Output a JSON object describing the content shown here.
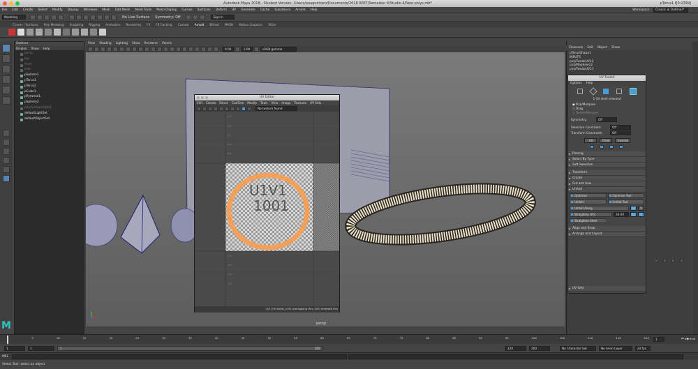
{
  "window": {
    "title": "Autodesk Maya 2018 - Student Version: /Users/anaquintero/Documents/2018 RMIT/Semester 4/Studio 4/New polys.mb*",
    "selection": "pTorus1.f[0:2399]"
  },
  "menubar": [
    "File",
    "Edit",
    "Create",
    "Select",
    "Modify",
    "Display",
    "Windows",
    "Mesh",
    "Edit Mesh",
    "Mesh Tools",
    "Mesh Display",
    "Curves",
    "Surfaces",
    "Deform",
    "UV",
    "Generate",
    "Cache",
    "Substance",
    "Arnold",
    "Help"
  ],
  "workspace": {
    "label": "Workspace :",
    "value": "Classic w Outliner*"
  },
  "statusline": {
    "mode": "Modeling",
    "live": "No Live Surface",
    "symmetry": "Symmetry: Off",
    "signin": "Sign In"
  },
  "shelf_tabs": [
    {
      "label": "Curves / Surfaces",
      "active": false
    },
    {
      "label": "Poly Modeling",
      "active": false
    },
    {
      "label": "Sculpting",
      "active": false
    },
    {
      "label": "Rigging",
      "active": false
    },
    {
      "label": "Animation",
      "active": false
    },
    {
      "label": "Rendering",
      "active": false
    },
    {
      "label": "FX",
      "active": false
    },
    {
      "label": "FX Caching",
      "active": false
    },
    {
      "label": "Custom",
      "active": false
    },
    {
      "label": "Arnold",
      "active": true
    },
    {
      "label": "Bifrost",
      "active": false
    },
    {
      "label": "MASH",
      "active": false
    },
    {
      "label": "Motion Graphics",
      "active": false
    },
    {
      "label": "XGen",
      "active": false
    }
  ],
  "outliner": {
    "title": "Outliner",
    "menu": [
      "Display",
      "Show",
      "Help"
    ],
    "items": [
      {
        "label": "persp",
        "dim": true
      },
      {
        "label": "top",
        "dim": true
      },
      {
        "label": "front",
        "dim": true
      },
      {
        "label": "side",
        "dim": true
      },
      {
        "label": "pSphere1",
        "dim": false
      },
      {
        "label": "pTorus1",
        "dim": false
      },
      {
        "label": "pTorus2",
        "dim": false
      },
      {
        "label": "pCube1",
        "dim": false
      },
      {
        "label": "pPyramid1",
        "dim": false
      },
      {
        "label": "pSphere2",
        "dim": false
      },
      {
        "label": "polySurfaceLight1",
        "dim": true
      },
      {
        "label": "defaultLightSet",
        "dim": false
      },
      {
        "label": "defaultObjectSet",
        "dim": false
      }
    ]
  },
  "viewport": {
    "menu": [
      "View",
      "Shading",
      "Lighting",
      "Show",
      "Renderer",
      "Panels"
    ],
    "exposure": "0.00",
    "gamma": "1.00",
    "colorspace": "sRGB gamma",
    "camera": "persp"
  },
  "uv_editor": {
    "title": "UV Editor",
    "menu": [
      "Edit",
      "Create",
      "Select",
      "Cut/Sew",
      "Modify",
      "Tools",
      "View",
      "Image",
      "Textures",
      "UV Sets"
    ],
    "texture_field": "No texture found",
    "tile_label_a": "U1V1",
    "tile_label_b": "1001",
    "status": "(1/1) UV shells, (0/0) overlapping UVs, (0/0) reversed UVs",
    "ruler_left": [
      "1.3",
      "1.2",
      "1.1",
      "1.0",
      "0.9",
      "0.8",
      "0.7",
      "0.6",
      "0.5",
      "0.4",
      "0.3",
      "0.2",
      "0.1",
      "0.0",
      "-0.1",
      "-0.2",
      "-0.3",
      "-0.4",
      "-0.5"
    ]
  },
  "channel_box": {
    "menu": [
      "Channels",
      "Edit",
      "Object",
      "Show"
    ],
    "object": "pTorusShape1",
    "inputs_label": "INPUTS",
    "inputs": [
      "polyTweakUV12",
      "polyMapSew12",
      "polyTweakUV11"
    ]
  },
  "uv_toolkit": {
    "title": "UV Toolkit",
    "menu": [
      "Options",
      "Help"
    ],
    "selection_info": "1 UV shell selected",
    "modes": [
      "Pick/Marquee",
      "Drag",
      "Tweak/Marquee"
    ],
    "symmetry_label": "Symmetry:",
    "symmetry_value": "Off",
    "sel_constraint_label": "Selection Constraint:",
    "sel_constraint_value": "Off",
    "trans_constraint_label": "Transform Constraint:",
    "trans_constraint_value": "Off",
    "select_buttons": [
      "All",
      "Clear",
      "Inverse"
    ],
    "sections_top": [
      "Pinning",
      "Select By Type",
      "Soft Selection"
    ],
    "sections_mid": [
      "Transform",
      "Create",
      "Cut and Sew"
    ],
    "unfold_section": "Unfold",
    "unfold_buttons": [
      [
        "Optimize",
        "Optimize Tool"
      ],
      [
        "Unfold",
        "Unfold Tool"
      ]
    ],
    "unfold_along": "Unfold Along",
    "unfold_u": "U",
    "unfold_v": "V",
    "straighten_uvs": "Straighten UVs",
    "straighten_value": "30.00",
    "straighten_shell": "Straighten Shell",
    "sections_bottom": [
      "Align and Snap",
      "Arrange and Layout"
    ],
    "uv_sets": "UV Sets"
  },
  "timeline": {
    "ticks": [
      "1",
      "5",
      "10",
      "15",
      "20",
      "25",
      "30",
      "35",
      "40",
      "45",
      "50",
      "55",
      "60",
      "65",
      "70",
      "75",
      "80",
      "85",
      "90",
      "95",
      "100",
      "105",
      "110",
      "115",
      "120"
    ],
    "current": "1"
  },
  "range": {
    "start": "1",
    "playstart": "1",
    "slider_value": "1",
    "slider_end": "120",
    "playend": "120",
    "end": "200",
    "character": "No Character Set",
    "anim_layer": "No Anim Layer",
    "fps": "24 fps"
  },
  "cmdline": {
    "label": "MEL"
  },
  "helpline": "Select Tool: select an object",
  "colors": {
    "accent": "#4a9bd6",
    "selection": "#f2a05a",
    "bg": "#444444"
  }
}
